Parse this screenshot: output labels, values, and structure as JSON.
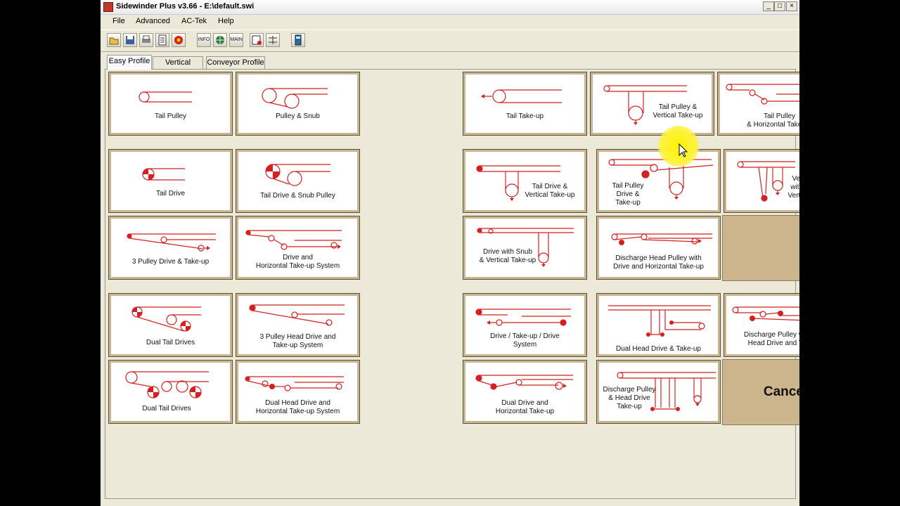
{
  "window": {
    "title": "Sidewinder Plus v3.66 - E:\\default.swi",
    "minimize": "_",
    "maximize": "□",
    "close": "×"
  },
  "menu": [
    "File",
    "Advanced",
    "AC-Tek",
    "Help"
  ],
  "toolbar": {
    "info_label": "INFO",
    "main_label": "MAIN"
  },
  "tabs": [
    "Easy Profile",
    "Vertical Profile",
    "Conveyor Profile"
  ],
  "profiles": {
    "tail_pulley": "Tail Pulley",
    "pulley_snub": "Pulley & Snub",
    "tail_takeup": "Tail Take-up",
    "tail_pulley_vertical": [
      "Tail Pulley &",
      "Vertical Take-up"
    ],
    "tail_pulley_horizontal": [
      "Tail Pulley",
      "& Horizontal Take-up"
    ],
    "tail_drive": "Tail Drive",
    "tail_drive_snub": "Tail Drive & Snub Pulley",
    "tail_drive_vertical": [
      "Tail Drive &",
      "Vertical Take-up"
    ],
    "tail_pulley_drive_takeup": [
      "Tail Pulley",
      "Drive &",
      "Take-up"
    ],
    "vertical_drive_snub": [
      "Vertical Drive",
      "with Snub and",
      "Vertical Take-up"
    ],
    "three_pulley_drive": "3 Pulley Drive & Take-up",
    "drive_horizontal_system": [
      "Drive and",
      "Horizontal Take-up System"
    ],
    "drive_snub_vertical": [
      "Drive with Snub",
      "& Vertical Take-up"
    ],
    "discharge_head_horizontal": [
      "Discharge Head Pulley with",
      "Drive and Horizontal Take-up"
    ],
    "dual_tail_drives_1": "Dual Tail Drives",
    "three_pulley_head_drive": [
      "3 Pulley Head Drive and",
      "Take-up System"
    ],
    "drive_takeup_drive": [
      "Drive / Take-up / Drive",
      "System"
    ],
    "dual_head_drive_takeup": "Dual Head Drive & Take-up",
    "discharge_dual_head": [
      "Discharge Pulley with Dual",
      "Head Drive and Take-up"
    ],
    "dual_tail_drives_2": "Dual Tail Drives",
    "dual_head_horizontal_system": [
      "Dual Head Drive and",
      "Horizontal Take-up System"
    ],
    "dual_drive_horizontal": [
      "Dual Drive and",
      "Horizontal Take-up"
    ],
    "discharge_head_drive_takeup": [
      "Discharge Pulley",
      "& Head Drive",
      "Take-up"
    ]
  },
  "cancel_label": "Cancel",
  "colors": {
    "belt": "#d42020",
    "tile_border": "#c8b692",
    "filler": "#ccb48c",
    "cursor_highlight": "#fff200"
  }
}
